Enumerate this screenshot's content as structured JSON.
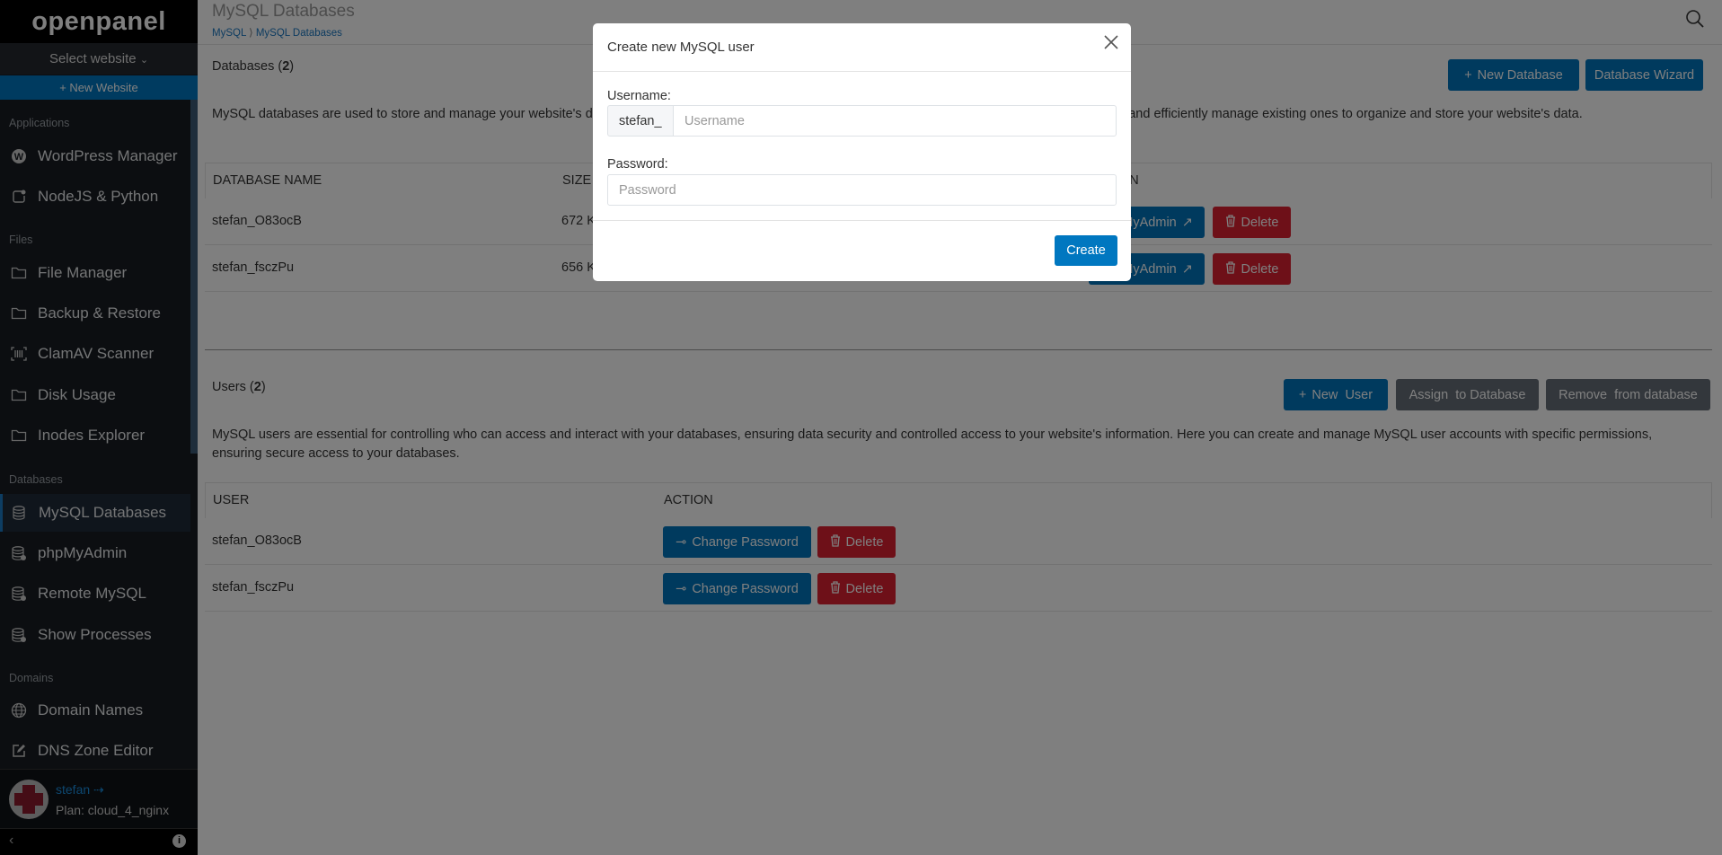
{
  "sidebar": {
    "logo": "openpanel",
    "select_website": "Select website",
    "new_website": "+ New Website",
    "sections": [
      {
        "label": "Applications",
        "items": [
          {
            "label": "WordPress Manager",
            "icon": "wordpress-icon"
          },
          {
            "label": "NodeJS & Python",
            "icon": "nodejs-icon"
          }
        ]
      },
      {
        "label": "Files",
        "items": [
          {
            "label": "File Manager",
            "icon": "folder-icon"
          },
          {
            "label": "Backup & Restore",
            "icon": "folder-check-icon"
          },
          {
            "label": "ClamAV Scanner",
            "icon": "barcode-scan-icon"
          },
          {
            "label": "Disk Usage",
            "icon": "folder-plus-icon"
          },
          {
            "label": "Inodes Explorer",
            "icon": "folder-x-icon"
          }
        ]
      },
      {
        "label": "Databases",
        "items": [
          {
            "label": "MySQL Databases",
            "icon": "database-icon",
            "active": true
          },
          {
            "label": "phpMyAdmin",
            "icon": "database-cog-icon"
          },
          {
            "label": "Remote MySQL",
            "icon": "database-info-icon"
          },
          {
            "label": "Show Processes",
            "icon": "database-process-icon"
          }
        ]
      },
      {
        "label": "Domains",
        "items": [
          {
            "label": "Domain Names",
            "icon": "globe-icon"
          },
          {
            "label": "DNS Zone Editor",
            "icon": "edit-icon"
          }
        ]
      }
    ],
    "user": {
      "name": "stefan",
      "plan": "Plan: cloud_4_nginx"
    }
  },
  "header": {
    "title": "MySQL Databases",
    "breadcrumb": [
      "MySQL",
      "MySQL Databases"
    ]
  },
  "databases": {
    "heading": "Databases (",
    "count": "2",
    "heading_end": ")",
    "new_button": "New Database",
    "wizard_button": "Database Wizard",
    "description": "MySQL databases are used to store and manage your website's data, organized for your web applications. On this page, you can easily create new databases and efficiently manage existing ones to organize and store your website's data.",
    "columns": [
      "DATABASE NAME",
      "SIZE",
      "ACTION"
    ],
    "rows": [
      {
        "name": "stefan_O83ocB",
        "size": "672 KB"
      },
      {
        "name": "stefan_fsczPu",
        "size": "656 KB"
      }
    ],
    "phpmyadmin_button": "phpMyAdmin",
    "delete_button": "Delete"
  },
  "users": {
    "heading": "Users (",
    "count": "2",
    "heading_end": ")",
    "new_button": "New  User",
    "assign_button": "Assign  to Database",
    "remove_button": "Remove  from database",
    "description": "MySQL users are essential for controlling who can access and interact with your databases, ensuring data security and controlled access to your website's information. Here you can create and manage MySQL user accounts with specific permissions, ensuring secure access to your databases.",
    "columns": [
      "USER",
      "ACTION"
    ],
    "rows": [
      {
        "name": "stefan_O83ocB"
      },
      {
        "name": "stefan_fsczPu"
      }
    ],
    "change_password_button": "Change Password",
    "delete_button": "Delete"
  },
  "modal": {
    "title": "Create new MySQL user",
    "username_label": "Username:",
    "username_prefix": "stefan_",
    "username_placeholder": "Username",
    "password_label": "Password:",
    "password_placeholder": "Password",
    "create_button": "Create"
  },
  "colors": {
    "primary": "#0074bc",
    "danger": "#dc2030",
    "secondary": "#666e78"
  }
}
